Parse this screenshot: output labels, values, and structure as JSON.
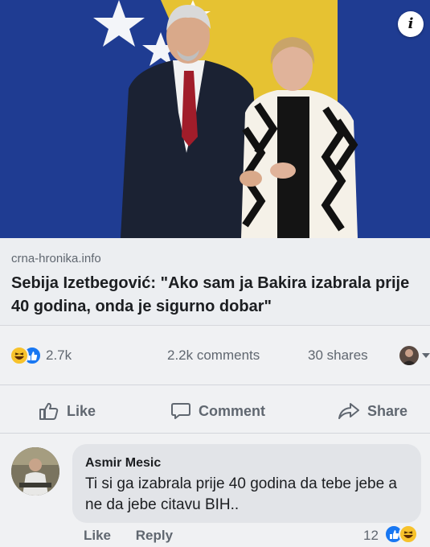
{
  "post": {
    "link_domain": "crna-hronika.info",
    "headline": "Sebija Izetbegović: \"Ako sam ja Bakira izabrala prije 40 godina, onda je sigurno dobar\"",
    "info_icon": "info-icon"
  },
  "stats": {
    "reaction_count": "2.7k",
    "comments": "2.2k comments",
    "shares": "30 shares",
    "reaction_icons": [
      "haha-icon",
      "like-icon"
    ]
  },
  "actions": {
    "like": "Like",
    "comment": "Comment",
    "share": "Share"
  },
  "comment": {
    "author": "Asmir Mesic",
    "text": "Ti si ga izabrala prije 40 godina da tebe jebe a ne da jebe citavu BIH..",
    "like_label": "Like",
    "reply_label": "Reply",
    "reaction_count": "12",
    "reaction_icons": [
      "like-icon",
      "haha-icon"
    ]
  },
  "colors": {
    "facebook_blue": "#1877f2",
    "haha_yellow": "#f7c22b",
    "flag_blue": "#1e3a8f",
    "flag_yellow": "#e8c233"
  }
}
